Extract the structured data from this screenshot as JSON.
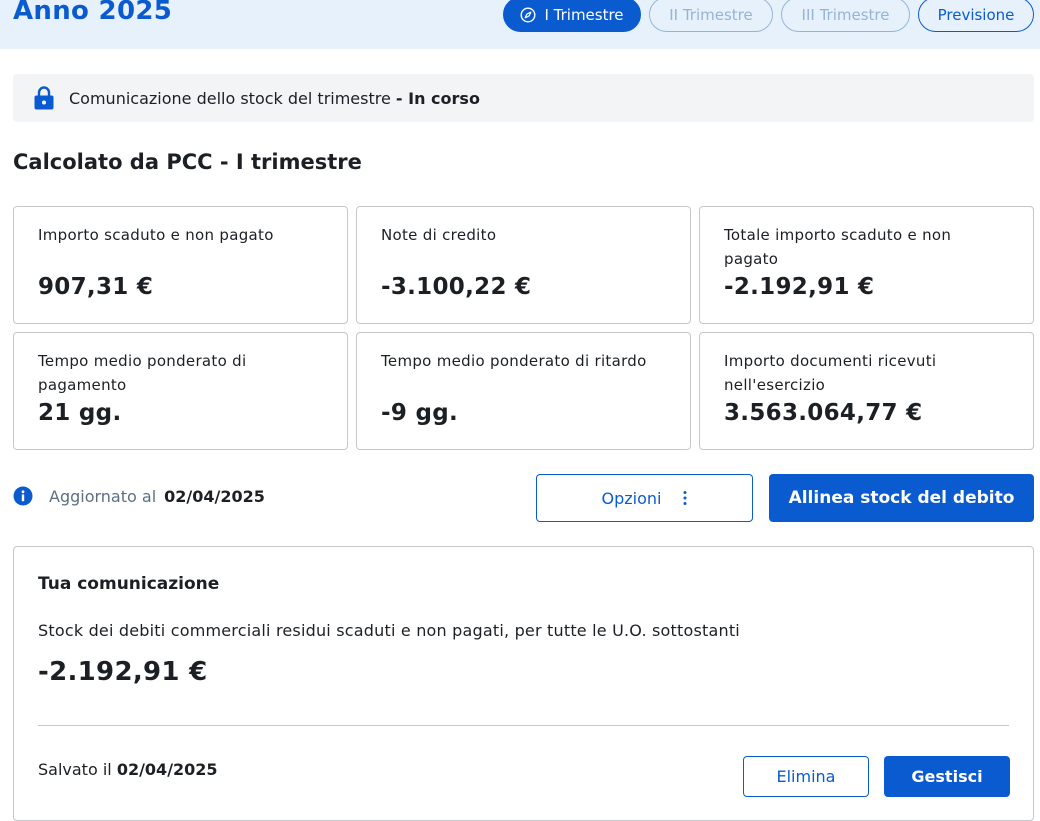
{
  "header": {
    "year_title": "Anno 2025",
    "tabs": [
      {
        "label": "I Trimestre",
        "state": "active"
      },
      {
        "label": "II Trimestre",
        "state": "disabled"
      },
      {
        "label": "III Trimestre",
        "state": "disabled"
      },
      {
        "label": "Previsione",
        "state": "outline"
      }
    ]
  },
  "status": {
    "text": "Comunicazione dello stock del trimestre",
    "state": "- In corso"
  },
  "section_title": "Calcolato da PCC - I trimestre",
  "cards": [
    {
      "label": "Importo scaduto e non pagato",
      "value": "907,31 €"
    },
    {
      "label": "Note di credito",
      "value": "-3.100,22 €"
    },
    {
      "label": "Totale importo scaduto e non pagato",
      "value": "-2.192,91 €"
    },
    {
      "label": "Tempo medio ponderato di pagamento",
      "value": "21 gg."
    },
    {
      "label": "Tempo medio ponderato di ritardo",
      "value": "-9 gg."
    },
    {
      "label": "Importo documenti ricevuti nell'esercizio",
      "value": "3.563.064,77 €"
    }
  ],
  "updated": {
    "label": "Aggiornato al",
    "date": "02/04/2025"
  },
  "actions": {
    "options_label": "Opzioni",
    "align_label": "Allinea stock del debito"
  },
  "communication": {
    "title": "Tua comunicazione",
    "description": "Stock dei debiti commerciali residui scaduti e non pagati, per tutte le U.O. sottostanti",
    "value": "-2.192,91 €",
    "saved_label": "Salvato il",
    "saved_date": "02/04/2025",
    "delete_label": "Elimina",
    "manage_label": "Gestisci"
  },
  "colors": {
    "primary": "#0b5bd0",
    "header_bg": "#e6f1fc",
    "disabled": "#96b4d8",
    "text": "#1c2024"
  }
}
